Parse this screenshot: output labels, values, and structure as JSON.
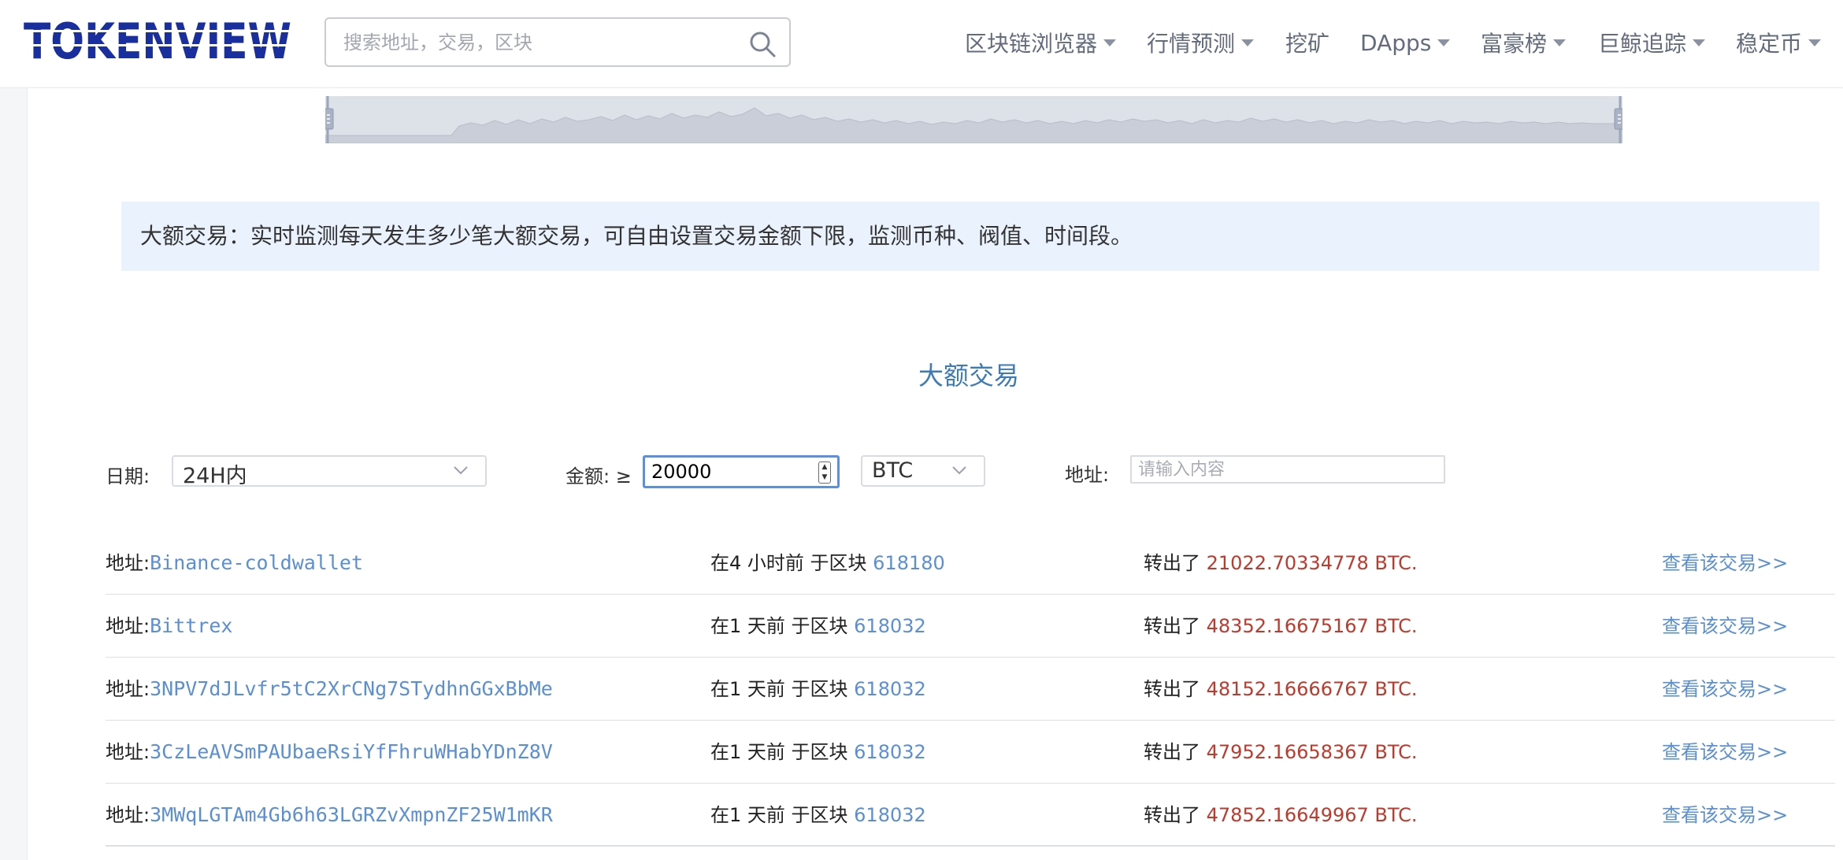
{
  "header": {
    "logo_text": "TOKENVIEW",
    "search_placeholder": "搜索地址，交易，区块",
    "nav": [
      {
        "label": "区块链浏览器",
        "has_dropdown": true
      },
      {
        "label": "行情预测",
        "has_dropdown": true
      },
      {
        "label": "挖矿",
        "has_dropdown": false
      },
      {
        "label": "DApps",
        "has_dropdown": true
      },
      {
        "label": "富豪榜",
        "has_dropdown": true
      },
      {
        "label": "巨鲸追踪",
        "has_dropdown": true
      },
      {
        "label": "稳定币",
        "has_dropdown": true
      }
    ]
  },
  "banner": {
    "text": "大额交易：实时监测每天发生多少笔大额交易，可自由设置交易金额下限，监测币种、阀值、时间段。"
  },
  "section": {
    "title": "大额交易"
  },
  "filters": {
    "date_label": "日期:",
    "date_value": "24H内",
    "amount_label": "金额: ≥",
    "amount_value": "20000",
    "currency_value": "BTC",
    "address_label": "地址:",
    "address_placeholder": "请输入内容"
  },
  "transactions": [
    {
      "address_prefix": "地址:",
      "address": "Binance-coldwallet",
      "time_prefix": "在4 小时前 于区块 ",
      "block": "618180",
      "amount_prefix": "转出了 ",
      "amount": "21022.70334778 BTC.",
      "view_link": "查看该交易>>"
    },
    {
      "address_prefix": "地址:",
      "address": "Bittrex",
      "time_prefix": "在1 天前 于区块 ",
      "block": "618032",
      "amount_prefix": "转出了 ",
      "amount": "48352.16675167 BTC.",
      "view_link": "查看该交易>>"
    },
    {
      "address_prefix": "地址:",
      "address": "3NPV7dJLvfr5tC2XrCNg7STydhnGGxBbMe",
      "time_prefix": "在1 天前 于区块 ",
      "block": "618032",
      "amount_prefix": "转出了 ",
      "amount": "48152.16666767 BTC.",
      "view_link": "查看该交易>>"
    },
    {
      "address_prefix": "地址:",
      "address": "3CzLeAVSmPAUbaeRsiYfFhruWHabYDnZ8V",
      "time_prefix": "在1 天前 于区块 ",
      "block": "618032",
      "amount_prefix": "转出了 ",
      "amount": "47952.16658367 BTC.",
      "view_link": "查看该交易>>"
    },
    {
      "address_prefix": "地址:",
      "address": "3MWqLGTAm4Gb6h63LGRZvXmpnZF25W1mKR",
      "time_prefix": "在1 天前 于区块 ",
      "block": "618032",
      "amount_prefix": "转出了 ",
      "amount": "47852.16649967 BTC.",
      "view_link": "查看该交易>>"
    }
  ],
  "colors": {
    "brand": "#1a2f9e",
    "link": "#5b8fd5",
    "amount": "#c0392b",
    "title": "#3d7ab8",
    "banner_bg": "#eaf3fd"
  }
}
